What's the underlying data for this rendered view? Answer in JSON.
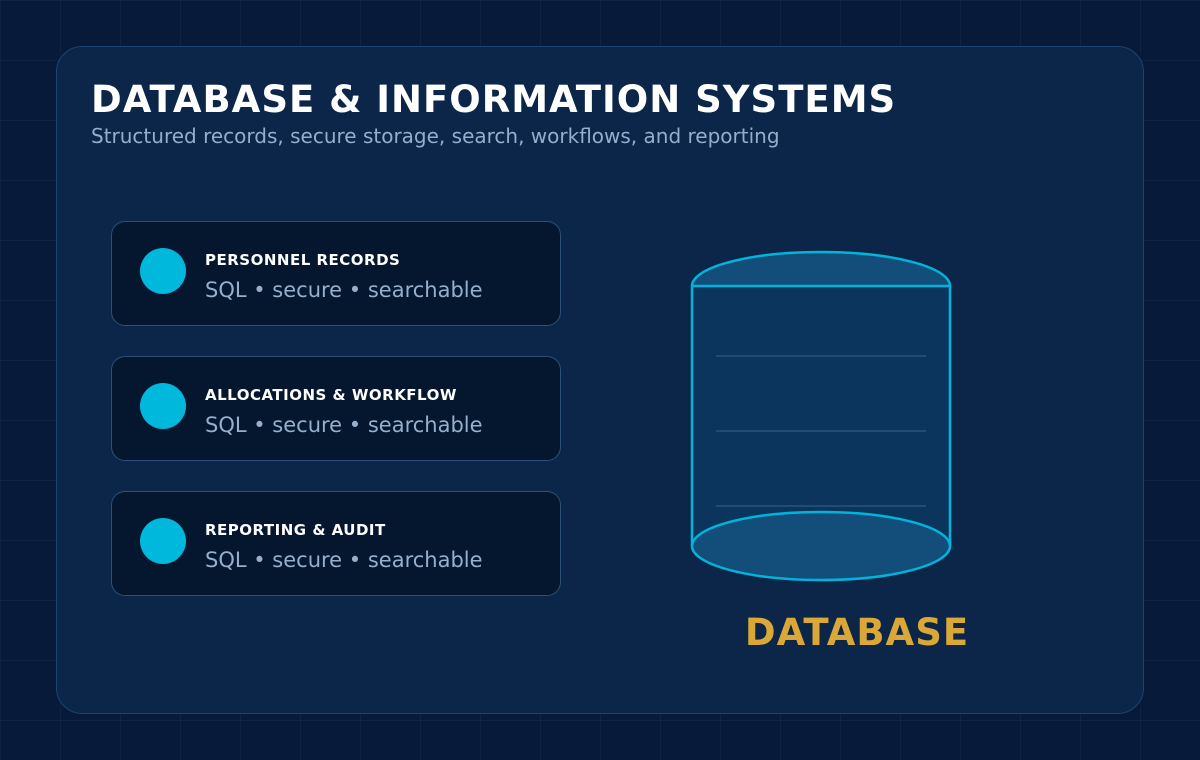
{
  "header": {
    "title": "DATABASE & INFORMATION SYSTEMS",
    "subtitle": "Structured records, secure storage, search, workflows, and reporting"
  },
  "cards": [
    {
      "title": "PERSONNEL RECORDS",
      "subtitle": "SQL • secure • searchable",
      "icon": "circle-icon"
    },
    {
      "title": "ALLOCATIONS & WORKFLOW",
      "subtitle": "SQL • secure • searchable",
      "icon": "circle-icon"
    },
    {
      "title": "REPORTING & AUDIT",
      "subtitle": "SQL • secure • searchable",
      "icon": "circle-icon"
    }
  ],
  "database": {
    "label": "DATABASE",
    "icon": "database-cylinder-icon"
  },
  "colors": {
    "background": "#071a3a",
    "panel": "#0b2649",
    "accent_cyan": "#00b8db",
    "label_gold": "#dba838",
    "card_background": "#05172f"
  }
}
